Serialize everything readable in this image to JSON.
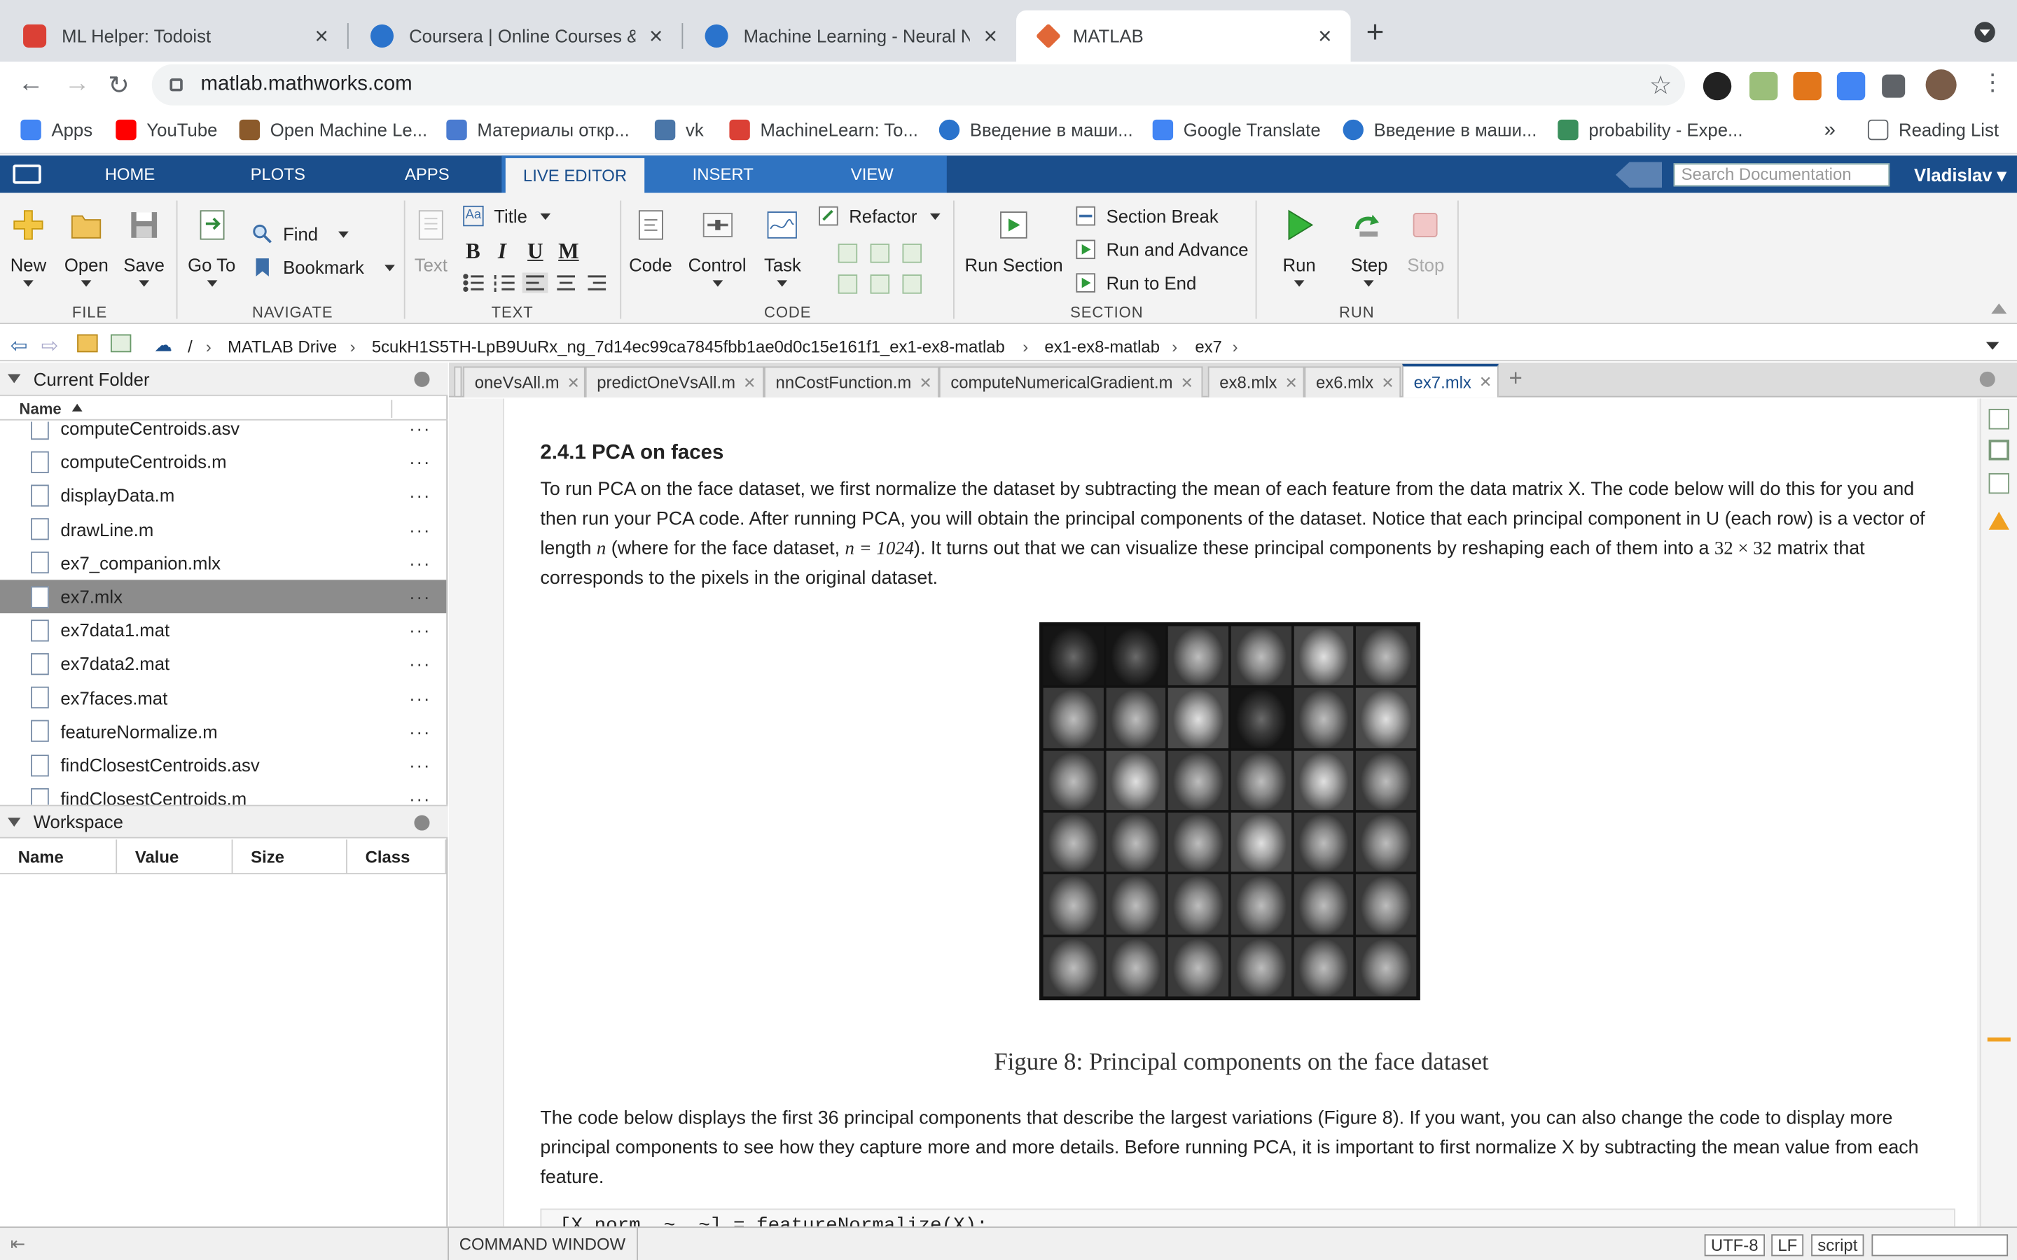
{
  "browser": {
    "tabs": [
      {
        "title": "ML Helper: Todoist",
        "color": "#db4035"
      },
      {
        "title": "Coursera | Online Courses & Cr",
        "color": "#2a73cc"
      },
      {
        "title": "Machine Learning - Neural Netw",
        "color": "#2a73cc"
      },
      {
        "title": "MATLAB",
        "color": "#e16737"
      }
    ],
    "url": "matlab.mathworks.com",
    "bookmarks": [
      {
        "label": "Apps",
        "color": "#4285f4"
      },
      {
        "label": "YouTube",
        "color": "#ff0000"
      },
      {
        "label": "Open Machine Le...",
        "color": "#8b5a2b"
      },
      {
        "label": "Материалы откр...",
        "color": "#4a7bd0"
      },
      {
        "label": "vk",
        "color": "#4a76a8"
      },
      {
        "label": "MachineLearn: To...",
        "color": "#db4035"
      },
      {
        "label": "Введение в маши...",
        "color": "#2a73cc"
      },
      {
        "label": "Google Translate",
        "color": "#4285f4"
      },
      {
        "label": "Введение в маши...",
        "color": "#2a73cc"
      },
      {
        "label": "probability - Expe...",
        "color": "#3a8f5c"
      }
    ],
    "overflow": "»",
    "reading_list": "Reading List"
  },
  "matlab": {
    "tabs": [
      "HOME",
      "PLOTS",
      "APPS",
      "LIVE EDITOR",
      "INSERT",
      "VIEW"
    ],
    "search_placeholder": "Search Documentation",
    "user": "Vladislav",
    "ribbon": {
      "file": {
        "new": "New",
        "open": "Open",
        "save": "Save",
        "group": "FILE"
      },
      "navigate": {
        "goto": "Go To",
        "find": "Find",
        "bookmark": "Bookmark",
        "group": "NAVIGATE"
      },
      "text": {
        "text": "Text",
        "title": "Title",
        "bold": "B",
        "italic": "I",
        "underline": "U",
        "mono": "M",
        "group": "TEXT"
      },
      "code": {
        "code": "Code",
        "control": "Control",
        "task": "Task",
        "refactor": "Refactor",
        "group": "CODE"
      },
      "section": {
        "run_section": "Run Section",
        "section_break": "Section Break",
        "run_advance": "Run and Advance",
        "run_end": "Run to End",
        "group": "SECTION"
      },
      "run": {
        "run": "Run",
        "step": "Step",
        "stop": "Stop",
        "group": "RUN"
      }
    },
    "path": [
      "/",
      "MATLAB Drive",
      "5cukH1S5TH-LpB9UuRx_ng_7d14ec99ca7845fbb1ae0d0c15e161f1_ex1-ex8-matlab",
      "ex1-ex8-matlab",
      "ex7"
    ]
  },
  "current_folder": {
    "title": "Current Folder",
    "column": "Name",
    "files": [
      {
        "name": "computeCentroids.asv",
        "selected": false
      },
      {
        "name": "computeCentroids.m",
        "selected": false
      },
      {
        "name": "displayData.m",
        "selected": false
      },
      {
        "name": "drawLine.m",
        "selected": false
      },
      {
        "name": "ex7_companion.mlx",
        "selected": false
      },
      {
        "name": "ex7.mlx",
        "selected": true
      },
      {
        "name": "ex7data1.mat",
        "selected": false
      },
      {
        "name": "ex7data2.mat",
        "selected": false
      },
      {
        "name": "ex7faces.mat",
        "selected": false
      },
      {
        "name": "featureNormalize.m",
        "selected": false
      },
      {
        "name": "findClosestCentroids.asv",
        "selected": false
      },
      {
        "name": "findClosestCentroids.m",
        "selected": false
      }
    ]
  },
  "workspace": {
    "title": "Workspace",
    "columns": [
      "Name",
      "Value",
      "Size",
      "Class"
    ]
  },
  "editor": {
    "tabs": [
      "oneVsAll.m",
      "predictOneVsAll.m",
      "nnCostFunction.m",
      "computeNumericalGradient.m",
      "ex8.mlx",
      "ex6.mlx",
      "ex7.mlx"
    ],
    "active_tab": "ex7.mlx",
    "heading": "2.4.1 PCA on faces",
    "para1": {
      "a": "To run PCA on the face dataset, we first normalize the dataset by subtracting the mean of each feature from the data matrix X. The code below will do this for you and then run your PCA code. After running PCA, you will obtain the principal components of the dataset. Notice that each principal component in U (each row) is a vector of length ",
      "m1": "n",
      "b": " (where for the face dataset, ",
      "m2": "n = 1024",
      "c": "). It turns out that we can visualize these principal components by reshaping each of them into a ",
      "m3": "32 × 32",
      "d": " matrix that corresponds to the pixels in the original dataset."
    },
    "caption": "Figure 8: Principal components on the face dataset",
    "para2": "The code below displays the first 36 principal components that describe the largest variations (Figure 8).  If you want, you can also change the code to display more principal components to see how they capture more and more details. Before running PCA, it is important to first normalize X by subtracting the mean value from each feature.",
    "code_line": "[X_norm, ~, ~] = featureNormalize(X);"
  },
  "status": {
    "command_window": "COMMAND WINDOW",
    "encoding": "UTF-8",
    "line_ending": "LF",
    "mode": "script"
  }
}
